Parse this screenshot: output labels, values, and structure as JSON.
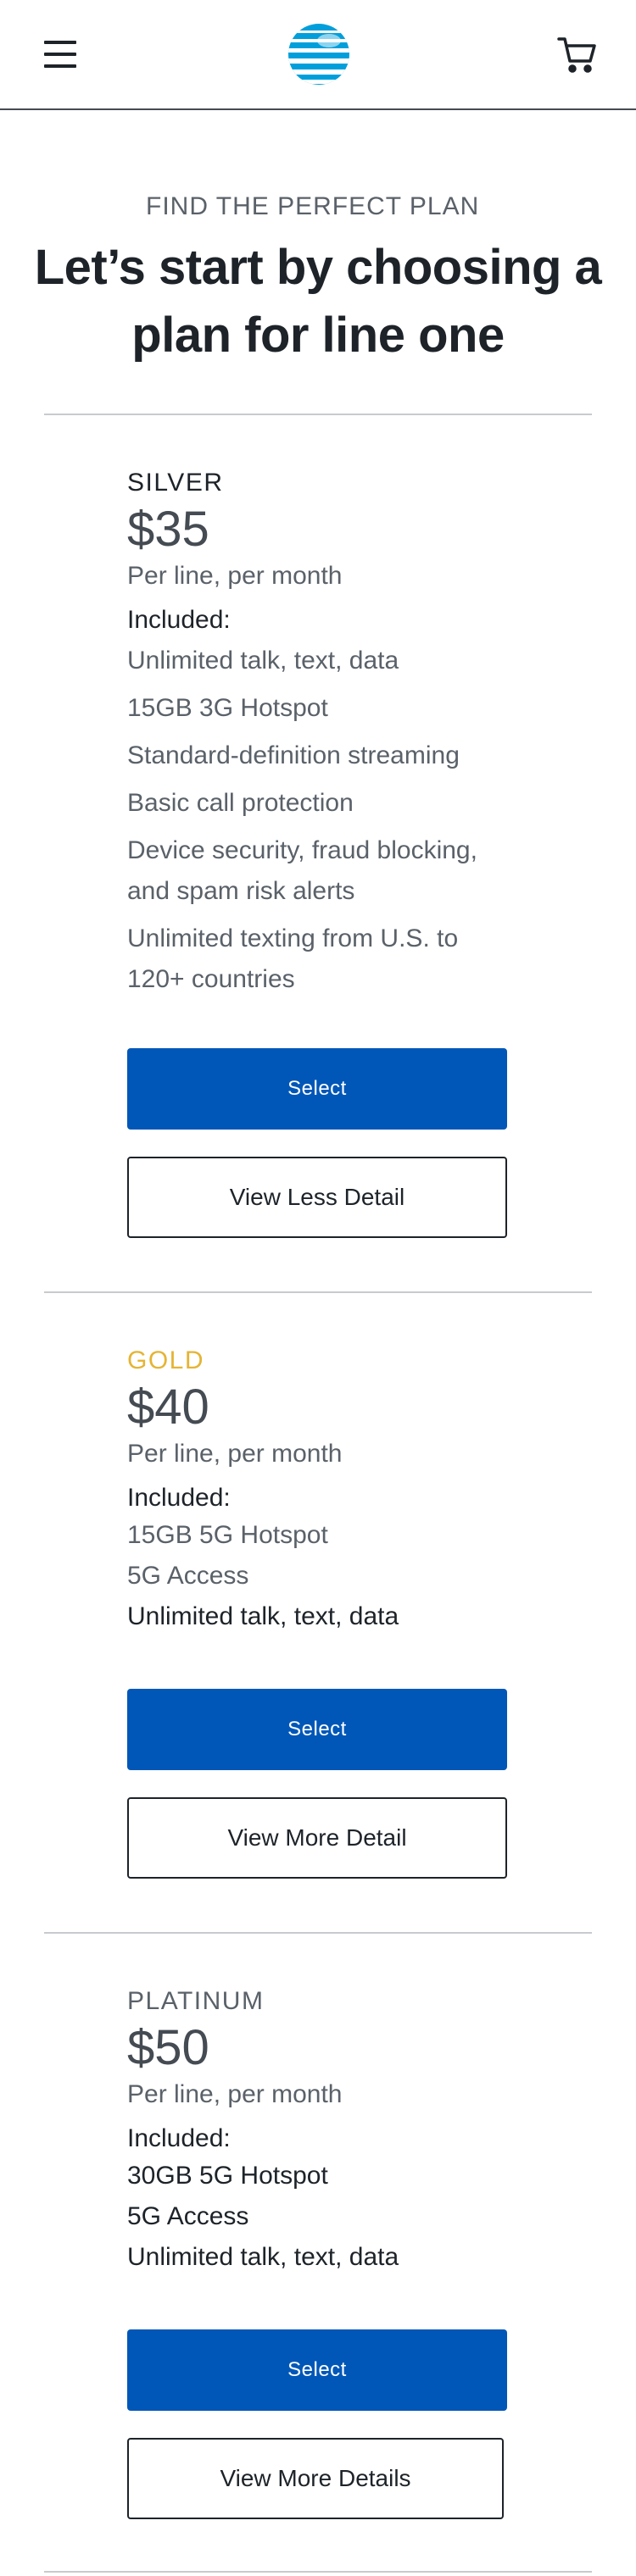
{
  "header": {
    "menu_icon": "hamburger-icon",
    "logo_icon": "att-globe-logo",
    "cart_icon": "cart-icon"
  },
  "intro": {
    "eyebrow": "FIND THE PERFECT PLAN",
    "headline": "Let’s start by choosing a plan for line one"
  },
  "plans": [
    {
      "tier": "SILVER",
      "price": "$35",
      "period": "Per line, per month",
      "included_label": "Included:",
      "features": [
        "Unlimited talk, text, data",
        "15GB 3G Hotspot",
        "Standard-definition streaming",
        "Basic call protection",
        "Device security, fraud blocking, and spam risk alerts",
        "Unlimited texting from U.S. to 120+ countries"
      ],
      "select_label": "Select",
      "detail_label": "View Less Detail"
    },
    {
      "tier": "GOLD",
      "price": "$40",
      "period": "Per line, per month",
      "included_label": "Included:",
      "features": [
        "15GB 5G Hotspot",
        "5G Access",
        "Unlimited talk, text, data"
      ],
      "select_label": "Select",
      "detail_label": "View More Detail"
    },
    {
      "tier": "PLATINUM",
      "price": "$50",
      "period": "Per line, per month",
      "included_label": "Included:",
      "features": [
        "30GB 5G Hotspot",
        "5G Access",
        "Unlimited talk, text, data"
      ],
      "select_label": "Select",
      "detail_label": "View More Details"
    }
  ],
  "colors": {
    "primary_button": "#0057b8",
    "gold_tier": "#e5b434",
    "text_dark": "#1d2329",
    "text_muted": "#5a6169"
  }
}
